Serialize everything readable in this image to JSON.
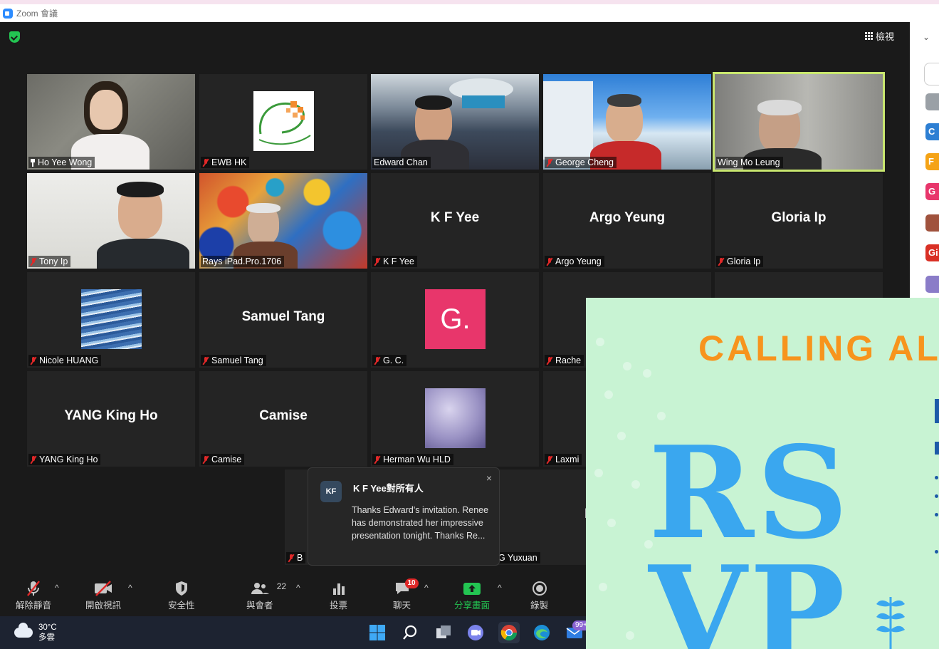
{
  "window": {
    "title": "Zoom 會議"
  },
  "header": {
    "view_label": "檢視"
  },
  "tiles": [
    {
      "name": "Ho Yee Wong",
      "pinned": true,
      "muted": false,
      "video": true
    },
    {
      "name": "EWB HK",
      "muted": true,
      "avatar": "logo"
    },
    {
      "name": "Edward Chan",
      "muted": false,
      "video": true
    },
    {
      "name": "George Cheng",
      "muted": true,
      "video": true
    },
    {
      "name": "Wing Mo Leung",
      "muted": false,
      "video": true,
      "active_speaker": true
    },
    {
      "name": "Tony Ip",
      "muted": true,
      "video": true
    },
    {
      "name": "Rays iPad.Pro.1706",
      "muted": false,
      "video": true
    },
    {
      "name": "K F Yee",
      "display_name": "K F Yee",
      "muted": true
    },
    {
      "name": "Argo Yeung",
      "display_name": "Argo Yeung",
      "muted": true
    },
    {
      "name": "Gloria Ip",
      "display_name": "Gloria Ip",
      "muted": true
    },
    {
      "name": "Nicole HUANG",
      "muted": true,
      "avatar": "water"
    },
    {
      "name": "Samuel Tang",
      "display_name": "Samuel Tang",
      "muted": true
    },
    {
      "name": "G. C.",
      "muted": true,
      "avatar_letter": "G.",
      "avatar_color": "#e8366b"
    },
    {
      "name": "Rache",
      "muted": true
    },
    {
      "name": "YANG King Ho",
      "display_name": "YANG King Ho",
      "muted": true
    },
    {
      "name": "Camise",
      "display_name": "Camise",
      "muted": true
    },
    {
      "name": "Herman Wu HLD",
      "muted": true,
      "avatar": "purple"
    },
    {
      "name": "Laxmi",
      "muted": true
    },
    {
      "name": "B",
      "muted": true
    },
    {
      "name": "G Yuxuan",
      "display_name": "HANG Yuxua",
      "muted": false
    }
  ],
  "notification": {
    "avatar_initials": "KF",
    "title": "K F Yee對所有人",
    "message": "Thanks Edward's invitation. Renee has demonstrated her impressive presentation tonight. Thanks Re...",
    "close_icon": "×"
  },
  "toolbar": {
    "unmute": "解除靜音",
    "start_video": "開啟視訊",
    "security": "安全性",
    "participants": "與會者",
    "participants_count": "22",
    "polls": "投票",
    "chat": "聊天",
    "chat_badge": "10",
    "share": "分享畫面",
    "record": "錄製"
  },
  "taskbar": {
    "temperature": "30°C",
    "weather": "多雲",
    "mail_badge": "99+"
  },
  "sidebar": {
    "avatars": [
      {
        "letter": "",
        "color": "#9aa0a6"
      },
      {
        "letter": "C",
        "color": "#2d7fd3"
      },
      {
        "letter": "F",
        "color": "#f5a316"
      },
      {
        "letter": "G",
        "color": "#e8366b"
      },
      {
        "letter": "",
        "color": "#a0523d"
      },
      {
        "letter": "Gi",
        "color": "#d93025"
      },
      {
        "letter": "",
        "color": "#8a7cc8"
      }
    ]
  },
  "poster": {
    "headline": "CALLING AL",
    "rsvp_line1": "RS",
    "rsvp_line2": "VP"
  },
  "colors": {
    "accent": "#2d8cff",
    "active_speaker_border": "#c9e76f",
    "muted_red": "#e02828",
    "share_green": "#23c552",
    "poster_bg": "#c8f3d3",
    "poster_orange": "#f7941d",
    "poster_blue": "#3aa7ef"
  }
}
